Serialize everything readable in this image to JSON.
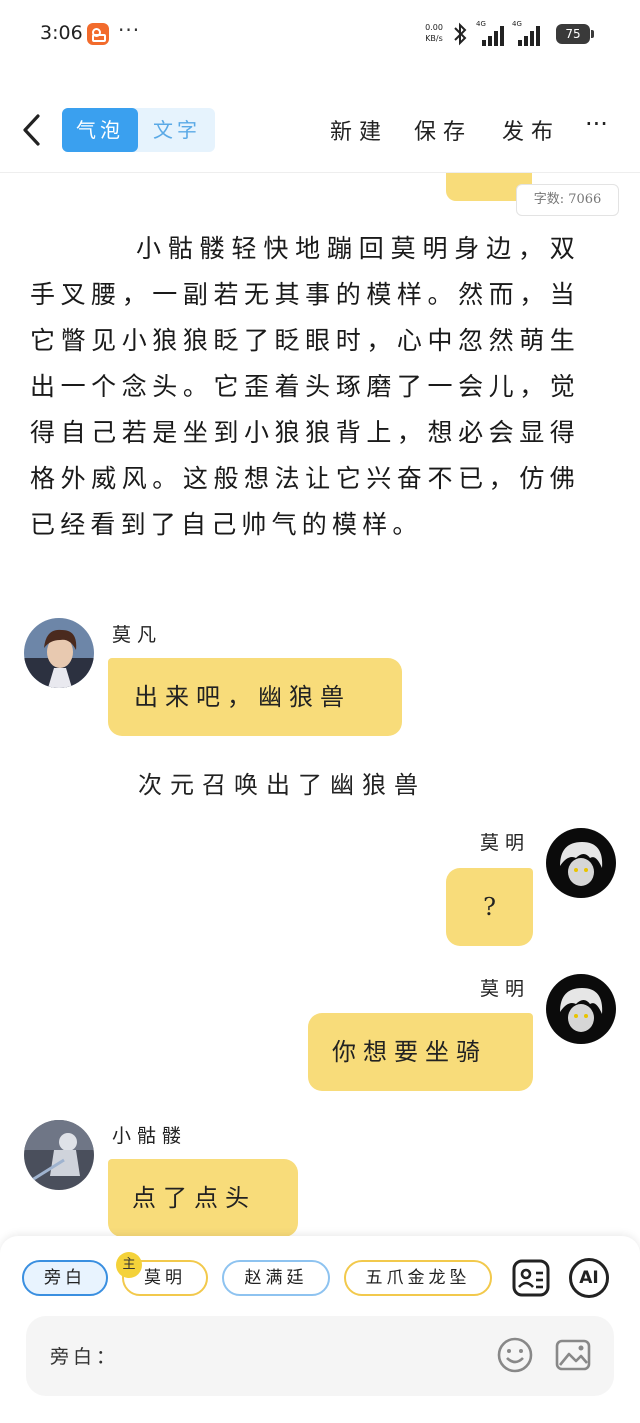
{
  "status_bar": {
    "time": "3:06",
    "more": "···",
    "net_speed_value": "0.00",
    "net_speed_unit": "KB/s",
    "signal1_label": "4G",
    "signal2_label": "4G",
    "battery": "75"
  },
  "header": {
    "tab_bubble": "气泡",
    "tab_text": "文字",
    "active_tab": "气泡",
    "new_label": "新建",
    "save_label": "保存",
    "publish_label": "发布",
    "more": "···"
  },
  "content": {
    "word_count": "字数: 7066",
    "narration_paragraph": "小骷髅轻快地蹦回莫明身边，双手叉腰，一副若无其事的模样。然而，当它瞥见小狼狼眨了眨眼时，心中忽然萌生出一个念头。它歪着头琢磨了一会儿，觉得自己若是坐到小狼狼背上，想必会显得格外威风。这般想法让它兴奋不已，仿佛已经看到了自己帅气的模样。",
    "messages": [
      {
        "speaker": "莫凡",
        "side": "left",
        "text": "出来吧，幽狼兽"
      },
      {
        "narration": "次元召唤出了幽狼兽"
      },
      {
        "speaker": "莫明",
        "side": "right",
        "text": "?"
      },
      {
        "speaker": "莫明",
        "side": "right",
        "text": "你想要坐骑"
      },
      {
        "speaker": "小骷髅",
        "side": "left",
        "text": "点了点头"
      }
    ]
  },
  "bottom_panel": {
    "roles": [
      "旁白",
      "莫明",
      "赵满廷",
      "五爪金龙坠"
    ],
    "selected_role": "旁白",
    "main_badge": "主",
    "ai_label": "AI",
    "input_label": "旁白："
  },
  "colors": {
    "bubble": "#f8dc7a",
    "accent_blue": "#3aa0ef",
    "chip_border_yellow": "#f2c94c"
  },
  "icons": [
    "back-icon",
    "contact-card-icon",
    "ai-icon",
    "emoji-icon",
    "image-icon",
    "bluetooth-icon"
  ]
}
